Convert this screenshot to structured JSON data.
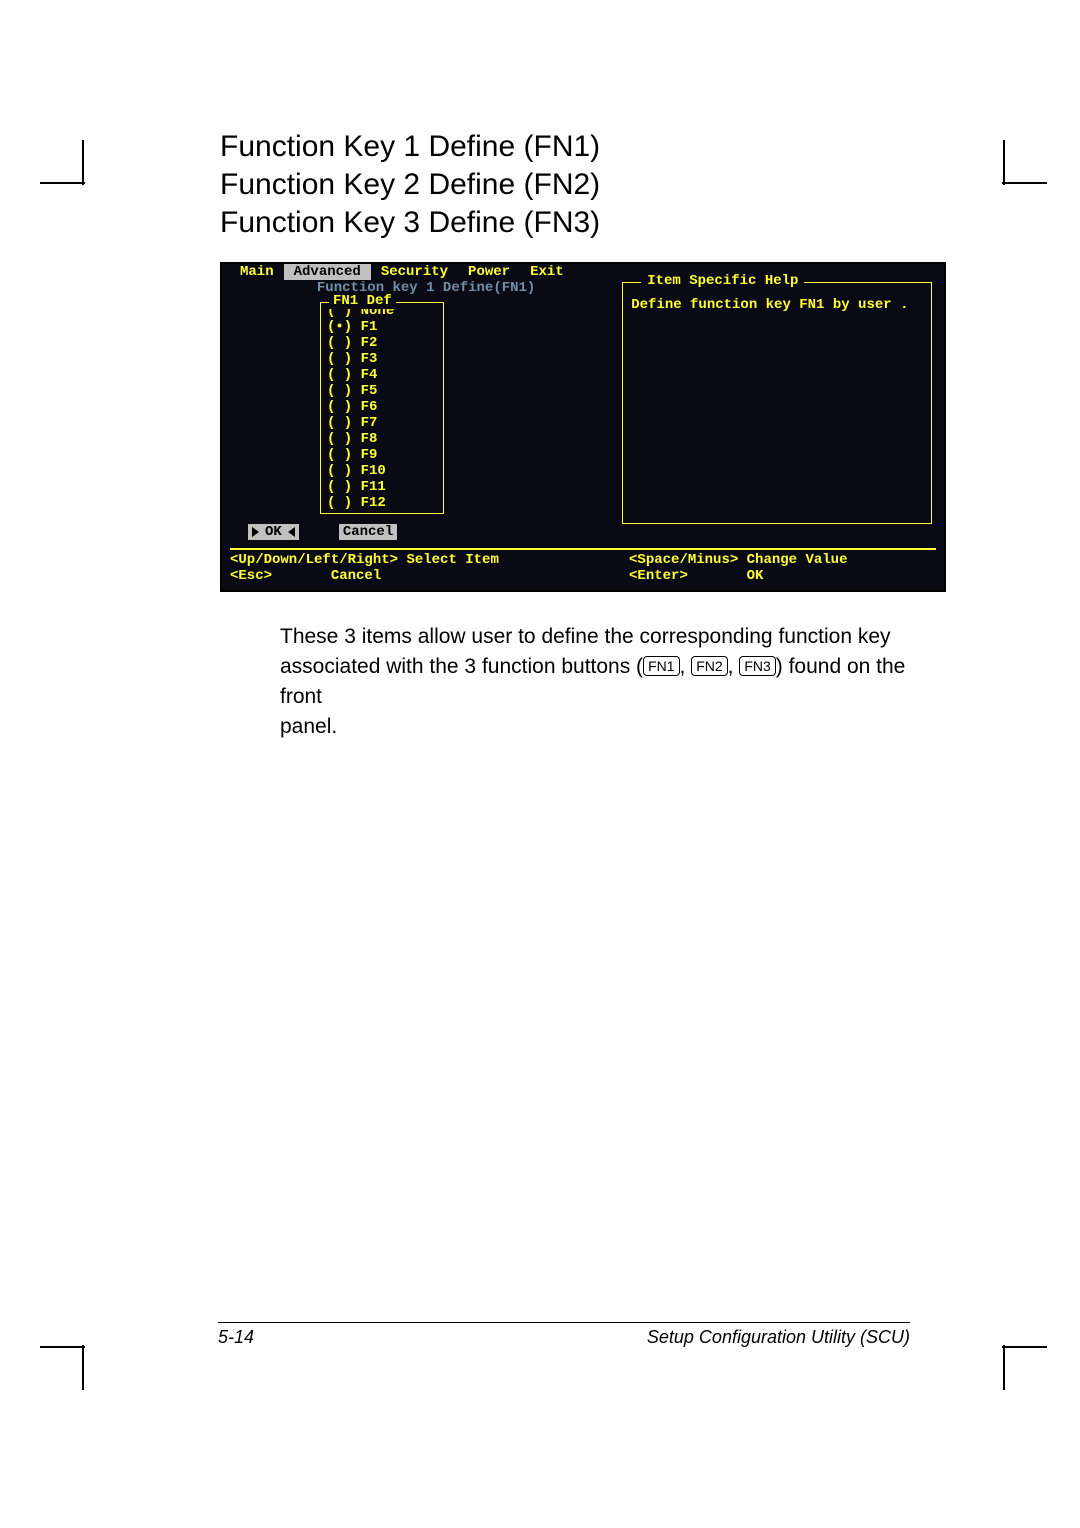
{
  "headings": {
    "h1": "Function Key 1 Define (FN1)",
    "h2": "Function Key 2 Define (FN2)",
    "h3": "Function Key 3 Define (FN3)"
  },
  "bios": {
    "menu": [
      "Main",
      "Advanced",
      "Security",
      "Power",
      "Exit"
    ],
    "active_menu_index": 1,
    "dialog_title": "Function key 1  Define(FN1)",
    "defbox": {
      "label": "FN1 Def",
      "options": [
        "None",
        "F1",
        "F2",
        "F3",
        "F4",
        "F5",
        "F6",
        "F7",
        "F8",
        "F9",
        "F10",
        "F11",
        "F12"
      ],
      "selected_index": 1
    },
    "buttons": {
      "ok": "OK",
      "cancel": "Cancel"
    },
    "help": {
      "title": "Item Specific Help",
      "text": "Define function key FN1 by user ."
    },
    "keys": {
      "k1a": "<Up/Down/Left/Right>",
      "k1b": "Select Item",
      "k2a": "<Space/Minus>",
      "k2b": "Change Value",
      "k3a": "<Esc>",
      "k3b": "Cancel",
      "k4a": "<Enter>",
      "k4b": "OK"
    }
  },
  "body": {
    "line1a": "These 3 items allow user to define the corresponding function key",
    "line2a": "associated with the 3 function buttons (",
    "fn1": "FN1",
    "sep": ", ",
    "fn2": "FN2",
    "fn3": "FN3",
    "line2b": ") found on the front",
    "line3": "panel."
  },
  "footer": {
    "page": "5-14",
    "title": "Setup Configuration Utility (SCU)"
  }
}
